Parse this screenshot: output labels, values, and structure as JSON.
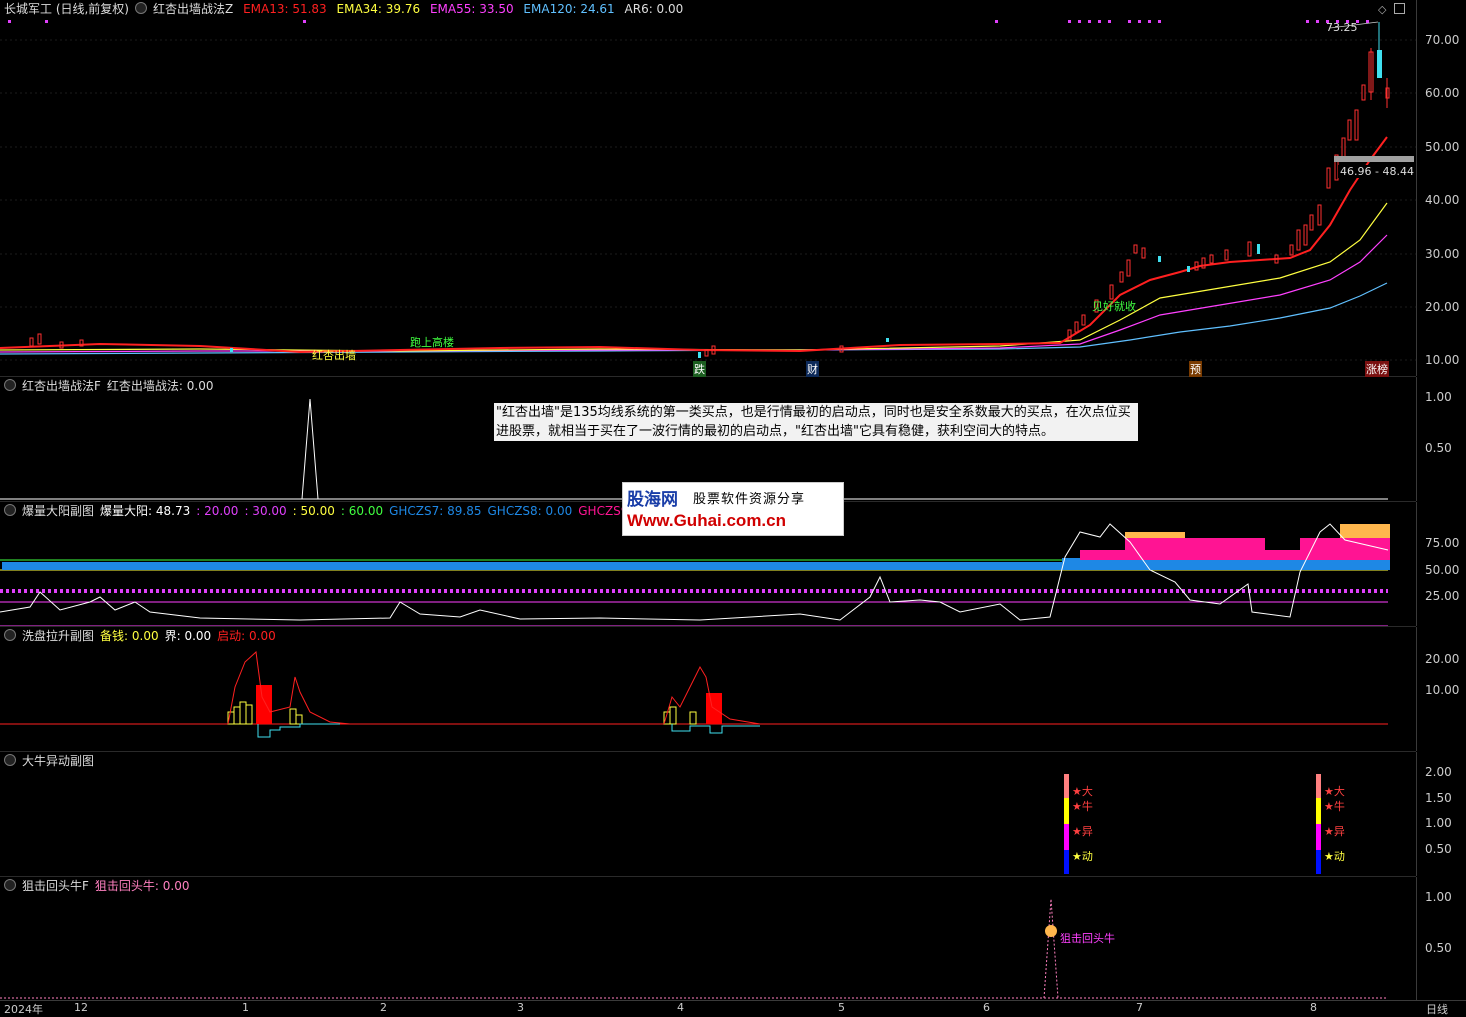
{
  "main": {
    "stock": "长城军工 (日线,前复权)",
    "indicator": "红杏出墙战法Z",
    "ema13": "EMA13: 51.83",
    "ema34": "EMA34: 39.76",
    "ema55": "EMA55: 33.50",
    "ema120": "EMA120: 24.61",
    "ar6": "AR6: 0.00",
    "y_ticks": [
      "70.00",
      "60.00",
      "50.00",
      "40.00",
      "30.00",
      "20.00",
      "10.00"
    ],
    "high_label": "73.25",
    "range_label": "46.96 - 48.44",
    "annotations": [
      "红杏出墙",
      "跑上高楼",
      "见好就收"
    ],
    "event_flags": [
      "跌",
      "财",
      "预",
      "涨榜"
    ]
  },
  "panel2": {
    "name": "红杏出墙战法F",
    "value": "红杏出墙战法: 0.00",
    "y_ticks": [
      "1.00",
      "0.50"
    ],
    "note": "\"红杏出墙\"是135均线系统的第一类买点，也是行情最初的启动点，同时也是安全系数最大的买点，在次点位买进股票，就相当于买在了一波行情的最初的启动点，\"红杏出墙\"它具有稳健，获利空间大的特点。"
  },
  "watermark": {
    "brand": "股海网",
    "slogan": "股票软件资源分享",
    "url": "Www.Guhai.com.cn"
  },
  "panel3": {
    "name": "爆量大阳副图",
    "v1": "爆量大阳: 48.73",
    "v2": ": 20.00",
    "v3": ": 30.00",
    "v4": ": 50.00",
    "v5": ": 60.00",
    "v6": "GHCZS7: 89.85",
    "v7": "GHCZS8: 0.00",
    "v8": "GHCZS9: 0.00",
    "y_ticks": [
      "75.00",
      "50.00",
      "25.00"
    ]
  },
  "panel4": {
    "name": "洗盘拉升副图",
    "v1": "备钱: 0.00",
    "v2": "界: 0.00",
    "v3": "启动: 0.00",
    "y_ticks": [
      "20.00",
      "10.00"
    ]
  },
  "panel5": {
    "name": "大牛异动副图",
    "y_ticks": [
      "2.00",
      "1.50",
      "1.00",
      "0.50"
    ],
    "labels": [
      "★大",
      "★牛",
      "★异",
      "★动"
    ]
  },
  "panel6": {
    "name": "狙击回头牛F",
    "value": "狙击回头牛: 0.00",
    "y_ticks": [
      "1.00",
      "0.50"
    ],
    "signal": "狙击回头牛"
  },
  "time_axis": [
    "2024年",
    "12",
    "1",
    "2",
    "3",
    "4",
    "5",
    "6",
    "7",
    "8"
  ],
  "period": "日线",
  "colors": {
    "ema13": "#ff2020",
    "ema34": "#ffff40",
    "ema55": "#ff40ff",
    "ema120": "#60c0ff"
  }
}
